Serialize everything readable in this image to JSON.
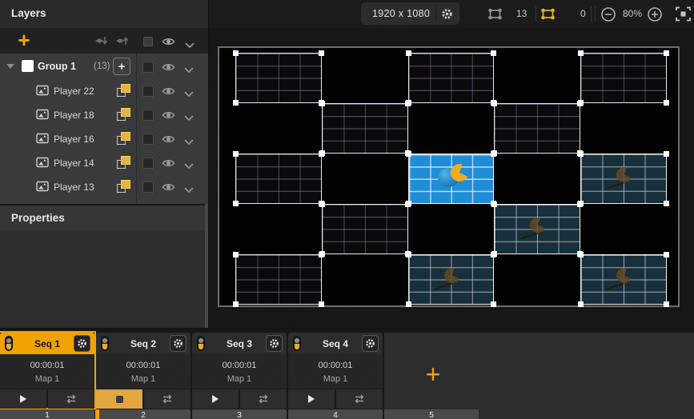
{
  "app": {
    "accent_color": "#F0A202",
    "selection_yellow": "#E8B31A",
    "media_blue": "#1E8ED6",
    "media_teal": "#18303B"
  },
  "icons": {
    "add": "+",
    "gear": "gear",
    "eye": "eye",
    "chevron_down": "chevron-down",
    "send_backward": "layer-down-arrow",
    "bring_forward": "layer-up-arrow",
    "image": "picture",
    "duplicate": "overlapping-squares",
    "play": "triangle",
    "stop": "square",
    "loop": "repeat-arrows",
    "zoom_out": "minus-circle",
    "zoom_in": "plus-circle",
    "fit": "fit-screen",
    "quad": "rect-with-corner-dots"
  },
  "layers_panel": {
    "title": "Layers",
    "group": {
      "label": "Group 1",
      "count": "(13)",
      "add_label": "+"
    },
    "players": [
      {
        "label": "Player 22"
      },
      {
        "label": "Player 18"
      },
      {
        "label": "Player 16"
      },
      {
        "label": "Player 14"
      },
      {
        "label": "Player 13"
      }
    ]
  },
  "properties_panel": {
    "title": "Properties"
  },
  "top_bar": {
    "resolution": "1920 x 1080",
    "shapes_total": "13",
    "shapes_selected": "0",
    "zoom_level": "80%"
  },
  "canvas": {
    "stage_rows": 5,
    "stage_cols": 5,
    "quads": [
      {
        "row": 1,
        "col": 1,
        "type": "wire"
      },
      {
        "row": 1,
        "col": 3,
        "type": "wire"
      },
      {
        "row": 1,
        "col": 5,
        "type": "wire"
      },
      {
        "row": 2,
        "col": 2,
        "type": "wire"
      },
      {
        "row": 2,
        "col": 4,
        "type": "wire"
      },
      {
        "row": 3,
        "col": 1,
        "type": "wire"
      },
      {
        "row": 3,
        "col": 3,
        "type": "media-bright"
      },
      {
        "row": 3,
        "col": 5,
        "type": "media-dim"
      },
      {
        "row": 4,
        "col": 2,
        "type": "wire"
      },
      {
        "row": 4,
        "col": 4,
        "type": "media-dim"
      },
      {
        "row": 5,
        "col": 1,
        "type": "wire"
      },
      {
        "row": 5,
        "col": 3,
        "type": "media-dim"
      },
      {
        "row": 5,
        "col": 5,
        "type": "media-dim"
      }
    ]
  },
  "sequencer": {
    "add_label": "+",
    "sequences": [
      {
        "name": "Seq 1",
        "duration": "00:00:01",
        "map": "Map 1",
        "selected": true,
        "playing": false
      },
      {
        "name": "Seq 2",
        "duration": "00:00:01",
        "map": "Map 1",
        "selected": false,
        "playing": true
      },
      {
        "name": "Seq 3",
        "duration": "00:00:01",
        "map": "Map 1",
        "selected": false,
        "playing": false
      },
      {
        "name": "Seq 4",
        "duration": "00:00:01",
        "map": "Map 1",
        "selected": false,
        "playing": false
      }
    ],
    "timeline": {
      "segments": [
        "1",
        "2",
        "3",
        "4",
        "5"
      ],
      "playhead_at_segment": "2"
    }
  }
}
